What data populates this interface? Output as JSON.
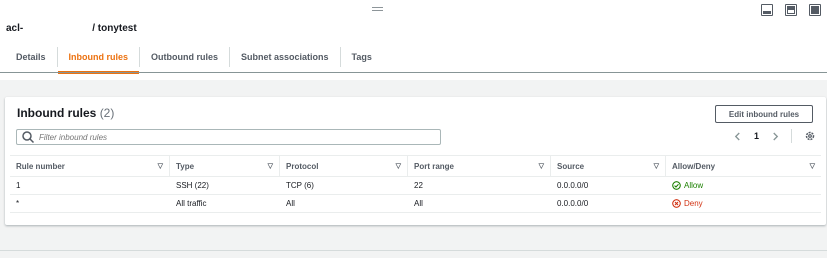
{
  "breadcrumb": {
    "prefix": "acl-",
    "suffix": "/ tonytest"
  },
  "tabs": [
    {
      "label": "Details",
      "active": false
    },
    {
      "label": "Inbound rules",
      "active": true
    },
    {
      "label": "Outbound rules",
      "active": false
    },
    {
      "label": "Subnet associations",
      "active": false
    },
    {
      "label": "Tags",
      "active": false
    }
  ],
  "panel": {
    "title": "Inbound rules",
    "count": "(2)",
    "edit_button": "Edit inbound rules",
    "filter_placeholder": "Filter inbound rules",
    "page": "1"
  },
  "table": {
    "columns": [
      "Rule number",
      "Type",
      "Protocol",
      "Port range",
      "Source",
      "Allow/Deny"
    ],
    "rows": [
      {
        "rule": "1",
        "type": "SSH (22)",
        "protocol": "TCP (6)",
        "port": "22",
        "source": "0.0.0.0/0",
        "action": "Allow"
      },
      {
        "rule": "*",
        "type": "All traffic",
        "protocol": "All",
        "port": "All",
        "source": "0.0.0.0/0",
        "action": "Deny"
      }
    ]
  },
  "colors": {
    "accent": "#ec7211",
    "allow": "#1d8102",
    "deny": "#d13212"
  }
}
